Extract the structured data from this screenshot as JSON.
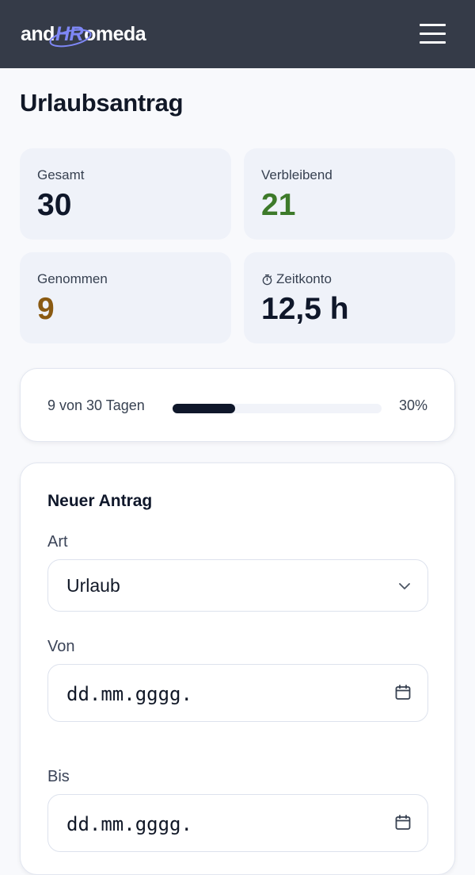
{
  "header": {
    "logo": {
      "prefix": "and",
      "highlight": "HR",
      "suffix": "omeda"
    },
    "menu_icon": "hamburger-menu-icon"
  },
  "page": {
    "title": "Urlaubsantrag"
  },
  "stats": {
    "total": {
      "label": "Gesamt",
      "value": "30",
      "color": "#0f172a"
    },
    "remaining": {
      "label": "Verbleibend",
      "value": "21",
      "color": "#3d7a2a"
    },
    "taken": {
      "label": "Genommen",
      "value": "9",
      "color": "#8a5a12"
    },
    "time_account": {
      "label": "Zeitkonto",
      "value": "12,5 h",
      "icon": "stopwatch-icon",
      "color": "#0f172a"
    }
  },
  "progress": {
    "text": "9 von 30 Tagen",
    "percent_label": "30%",
    "fraction": 0.3
  },
  "form": {
    "title": "Neuer Antrag",
    "type": {
      "label": "Art",
      "value": "Urlaub",
      "icon": "chevron-down-icon"
    },
    "from": {
      "label": "Von",
      "placeholder": "dd.mm.gggg.",
      "icon": "calendar-icon"
    },
    "to": {
      "label": "Bis",
      "placeholder": "dd.mm.gggg.",
      "icon": "calendar-icon"
    }
  },
  "colors": {
    "header_bg": "#353b48",
    "accent": "#7e87f5",
    "card_bg": "#eff2f9"
  }
}
